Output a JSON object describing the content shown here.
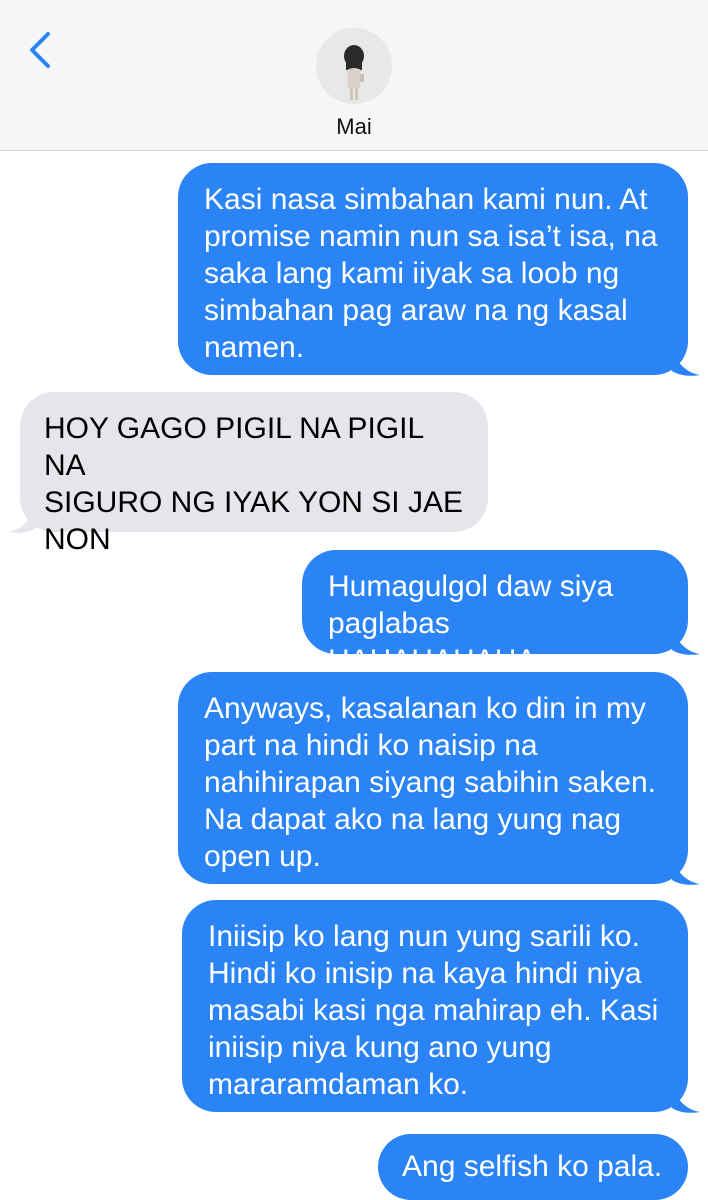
{
  "header": {
    "back_icon": "chevron-left-icon",
    "contact_name": "Mai",
    "avatar_icon": "contact-avatar"
  },
  "messages": [
    {
      "direction": "sent",
      "text": "Kasi nasa simbahan kami nun. At\npromise namin nun sa isa’t isa, na\nsaka lang kami iiyak sa loob ng\nsimbahan pag araw na ng kasal\nnamen."
    },
    {
      "direction": "received",
      "text": "HOY GAGO PIGIL NA PIGIL NA\nSIGURO NG IYAK YON SI JAE\nNON"
    },
    {
      "direction": "sent",
      "text": "Humagulgol daw siya\npaglabas HAHAHAHAHA"
    },
    {
      "direction": "sent",
      "text": "Anyways, kasalanan ko din in my\npart na hindi ko naisip na\nnahihirapan siyang sabihin saken.\nNa dapat ako na lang yung nag\nopen up."
    },
    {
      "direction": "sent",
      "text": "Iniisip ko lang nun yung sarili ko.\nHindi ko inisip na kaya hindi niya\nmasabi kasi nga mahirap eh. Kasi\niniisip niya kung ano yung\nmararamdaman ko."
    },
    {
      "direction": "sent",
      "text": "Ang selfish ko pala."
    }
  ],
  "colors": {
    "sent_bubble": "#2b84f6",
    "received_bubble": "#e6e5eb",
    "header_bg": "#f6f6f6",
    "accent": "#2b84f6"
  }
}
